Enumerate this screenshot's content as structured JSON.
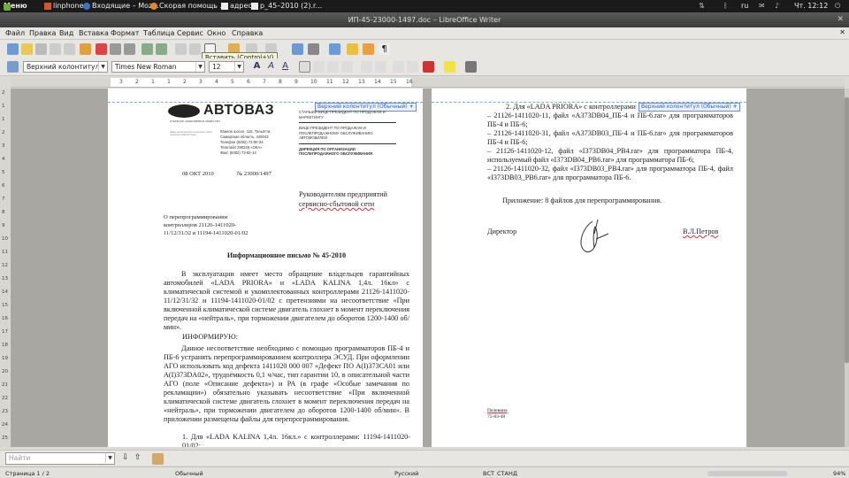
{
  "panel": {
    "menu_label": "Меню",
    "tasks": [
      "linphone",
      "Входящие – Moz...",
      "Скорая помощь ...",
      "адреса",
      "р_45–2010 (2).r..."
    ],
    "lang": "ru",
    "clock": "Чт. 12:12"
  },
  "window": {
    "title": "ИП-45-23000-1497.doc – LibreOffice Writer"
  },
  "menu": [
    "Файл",
    "Правка",
    "Вид",
    "Вставка",
    "Формат",
    "Таблица",
    "Сервис",
    "Окно",
    "Справка"
  ],
  "toolbar": {
    "tooltip": "Вставить (Control+V)"
  },
  "format": {
    "style": "Верхний колонтитул",
    "font": "Times New Roman",
    "size": "12"
  },
  "ruler": {
    "labels": [
      "3",
      "2",
      "1",
      "1",
      "2",
      "3",
      "4",
      "5",
      "6",
      "7",
      "8",
      "9",
      "10",
      "11",
      "12",
      "13",
      "14",
      "15",
      "16"
    ]
  },
  "vruler": {
    "labels": [
      "2",
      "1",
      "1",
      "2",
      "3",
      "4",
      "5",
      "6",
      "7",
      "8",
      "9",
      "10",
      "11",
      "12",
      "13",
      "14",
      "15",
      "16",
      "17",
      "18",
      "19",
      "20",
      "21",
      "22",
      "23",
      "24",
      "25"
    ]
  },
  "page1": {
    "header_tag": "Верхний колонтитул (Обычный)",
    "logo_text": "АВТОВАЗ",
    "logo_sub": "ОТКРЫТОЕ АКЦИОНЕРНОЕ ОБЩЕСТВО",
    "addr_lines": [
      "Южное шоссе, 115, Тольятти,",
      "Самарская область, 445043",
      "Телефон (8482) 73-80-34",
      "Телетайп 290245 «ОКА»",
      "Факс (8482) 73-82-14"
    ],
    "codes": "ОКПО 00232934 ОГРН 1026301983113 ИНН 6320002223 КПП 997750001",
    "dept1": "СТАРШИЙ ВИЦЕ-ПРЕЗИДЕНТ ПО ПРОДАЖАМ И МАРКЕТИНГУ",
    "dept2": "ВИЦЕ-ПРЕЗИДЕНТ ПО ПРОДАЖАМ И ПОСЛЕПРОДАЖНОМУ ОБСЛУЖИВАНИЮ АВТОМОБИЛЕЙ",
    "dept3": "ДИРЕКЦИЯ ПО ОРГАНИЗАЦИИ ПОСЛЕПРОДАЖНОГО ОБСЛУЖИВАНИЯ",
    "date": "08 ОКТ 2010",
    "number": "№ 23000/1497",
    "addressee1": "Руководителям предприятий",
    "addressee2": "сервисно-сбытовой сети",
    "subject": [
      "О перепрограммировании",
      "контроллеров 21126-1411020-",
      "11/12/31/32 и 11194-1411020-01/02"
    ],
    "letter_title": "Информационное письмо № 45-2010",
    "para1": "В эксплуатации имеет место обращение владельцев гарантийных автомобилей «LADA PRIORA» и «LADA KALINA 1,4л. 16кл» с климатической системой и укомплектованных контроллерами 21126-1411020-11/12/31/32 и 11194-1411020-01/02 с претензиями на несоответствие «При включенной климатической системе двигатель глохнет в момент переключения передач на «нейтраль», при торможении двигателем до оборотов 1200-1400 об/мин».",
    "inform": "ИНФОРМИРУЮ:",
    "para2": "Данное несоответствие необходимо с помощью программаторов ПБ-4 и ПБ-6 устранять перепрограммированием контроллера ЭСУД. При оформлении АГО использовать код дефекта 1411020 000 007 «Дефект ПО А(I)373СА01 или А(I)373DA02», трудоёмкость 0,1 ч/час, тип гарантии 10, в описательной части АГО (поле «Описание дефекта») и РА (в графе «Особые замечания по рекламации») обязательно указывать несоответствие «При включенной климатической системе двигатель глохнет в момент переключения передач на «нейтраль», при торможении двигателем до оборотов 1200-1400 об/мин». В приложении размещены файлы для перепрограммирования.",
    "item1": "1. Для «LADA KALINA 1,4л. 16кл.» с контроллерами: 11194-1411020-01/02:"
  },
  "page2": {
    "header_tag": "Верхний колонтитул (Обычный)",
    "item2": "2. Для «LADA PRIORA» с контроллерами",
    "lines": [
      "– 21126-1411020-11, файл «A373DB04_ПБ-4 и ПБ-6.rar» для программаторов ПБ-4 и ПБ-6;",
      "– 21126-1411020-31, файл «A373DB03_ПБ-4 и ПБ-6.rar» для программаторов ПБ-4 и ПБ-6;",
      "– 21126-1411020-12, файл «I373DB04_PB4.rar» для программатора ПБ-4, используемый файл «I373DB04_PB6.rar» для программатора ПБ-6;",
      "– 21126-1411020-32, файл «I373DB03_PB4.rar» для программатора ПБ-4, файл «I373DB03_PB6.rar» для программатора ПБ-6."
    ],
    "attachment": "Приложение: 8 файлов для перепрограммирования.",
    "director_label": "Директор",
    "director_name": "В.Л.Петров",
    "footer1": "Пелевина",
    "footer2": "75-83-48"
  },
  "find": {
    "placeholder": "Найти"
  },
  "status": {
    "page": "Страница 1 / 2",
    "style": "Обычный",
    "lang": "Русский",
    "ins": "ВСТ",
    "sel": "СТАНД",
    "zoom": "94%"
  }
}
